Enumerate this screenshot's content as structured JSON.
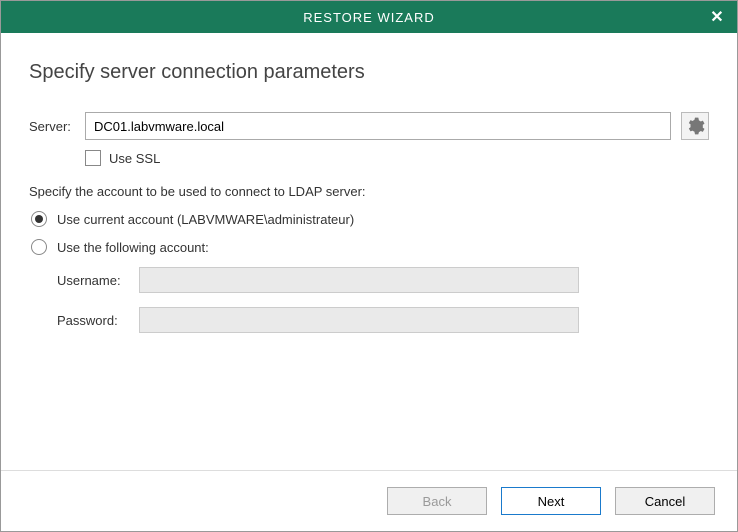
{
  "titlebar": {
    "title": "RESTORE WIZARD"
  },
  "heading": "Specify server connection parameters",
  "server": {
    "label": "Server:",
    "value": "DC01.labvmware.local"
  },
  "ssl": {
    "label": "Use SSL",
    "checked": false
  },
  "instruction": "Specify the account to be used to connect to LDAP server:",
  "account": {
    "current": {
      "label": "Use current account (LABVMWARE\\administrateur)",
      "selected": true
    },
    "other": {
      "label": "Use the following account:",
      "selected": false
    }
  },
  "credentials": {
    "username_label": "Username:",
    "username_value": "",
    "password_label": "Password:",
    "password_value": ""
  },
  "footer": {
    "back": "Back",
    "next": "Next",
    "cancel": "Cancel"
  }
}
